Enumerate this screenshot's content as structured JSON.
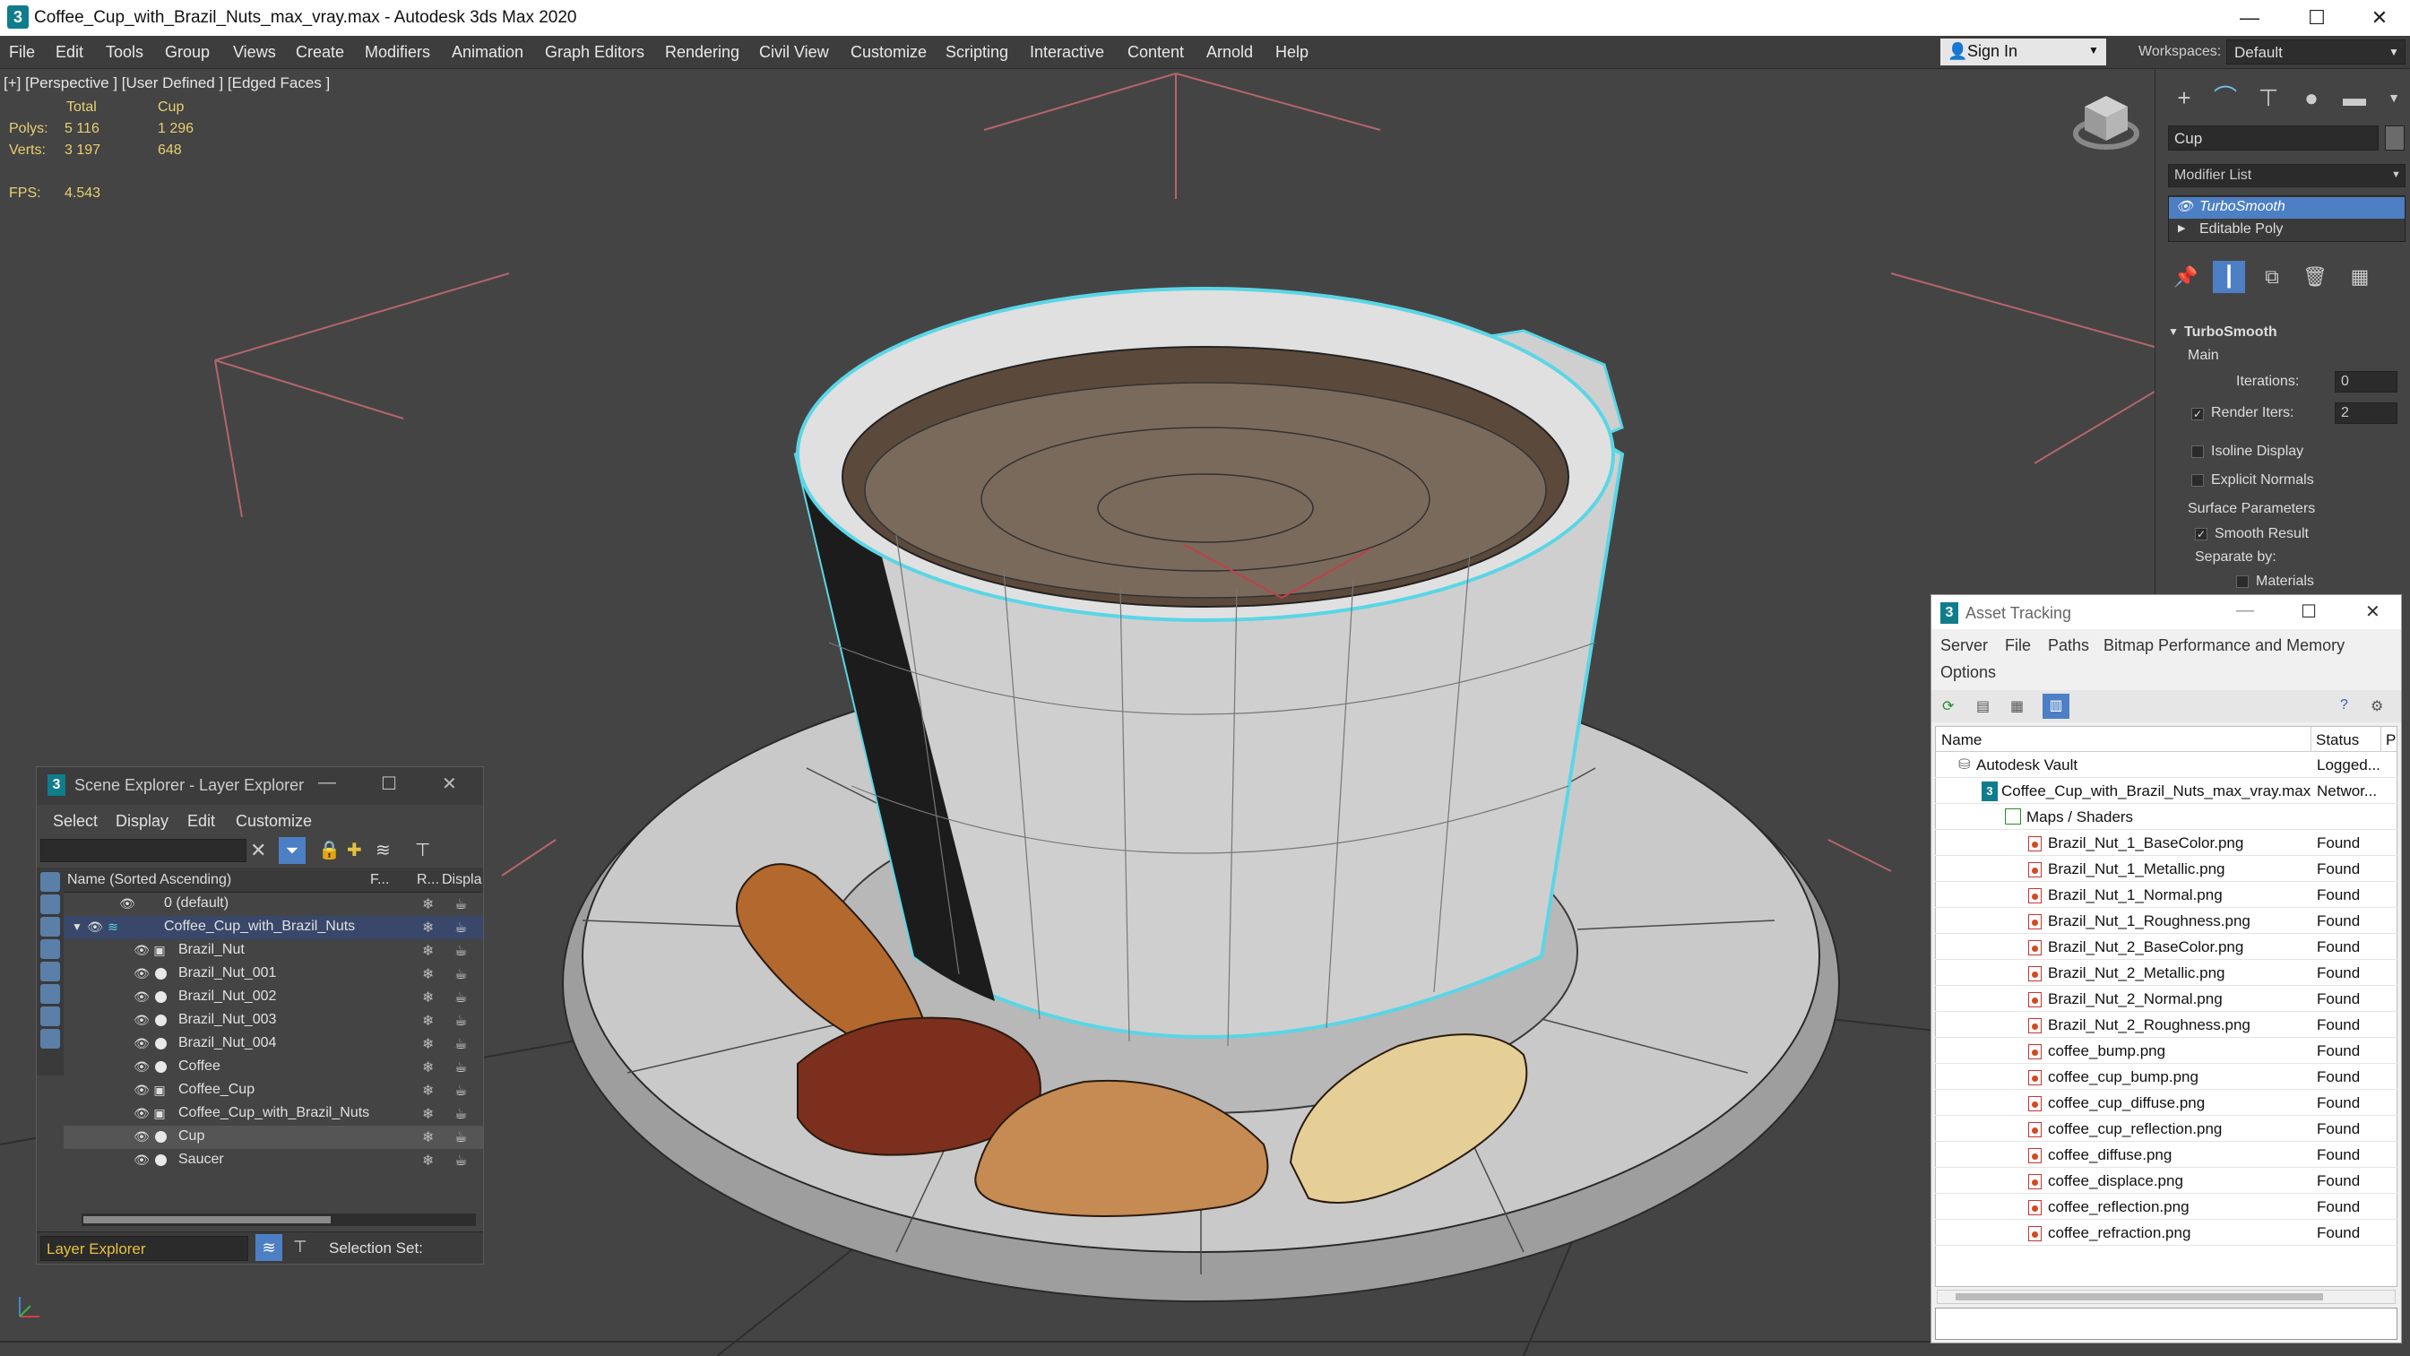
{
  "window": {
    "title": "Coffee_Cup_with_Brazil_Nuts_max_vray.max - Autodesk 3ds Max 2020",
    "logo": "3",
    "min": "—",
    "max": "☐",
    "close": "✕"
  },
  "menu": [
    "File",
    "Edit",
    "Tools",
    "Group",
    "Views",
    "Create",
    "Modifiers",
    "Animation",
    "Graph Editors",
    "Rendering",
    "Civil View",
    "Customize",
    "Scripting",
    "Interactive",
    "Content",
    "Arnold",
    "Help"
  ],
  "signin": {
    "label": "Sign In"
  },
  "workspaces": {
    "label": "Workspaces:",
    "value": "Default"
  },
  "viewport": {
    "label": "[+] [Perspective ] [User Defined ] [Edged Faces ]",
    "stats": {
      "col_total": "Total",
      "col_sel": "Cup",
      "polys_label": "Polys:",
      "polys_total": "5 116",
      "polys_sel": "1 296",
      "verts_label": "Verts:",
      "verts_total": "3 197",
      "verts_sel": "648",
      "fps_label": "FPS:",
      "fps": "4.543"
    }
  },
  "command_panel": {
    "object_name": "Cup",
    "modifier_list": "Modifier List",
    "stack": [
      "TurboSmooth",
      "Editable Poly"
    ],
    "rollout_title": "TurboSmooth",
    "main": "Main",
    "iterations_label": "Iterations:",
    "iterations": "0",
    "render_iters_label": "Render Iters:",
    "render_iters": "2",
    "isoline": "Isoline Display",
    "explicit": "Explicit Normals",
    "surface": "Surface Parameters",
    "smooth_result": "Smooth Result",
    "separate_by": "Separate by:",
    "materials": "Materials"
  },
  "scene_explorer": {
    "title": "Scene Explorer - Layer Explorer",
    "menu": [
      "Select",
      "Display",
      "Edit",
      "Customize"
    ],
    "col_name": "Name (Sorted Ascending)",
    "col_f": "F...",
    "col_r": "R...",
    "col_d": "Displa",
    "rows": [
      "0 (default)",
      "Coffee_Cup_with_Brazil_Nuts",
      "Brazil_Nut",
      "Brazil_Nut_001",
      "Brazil_Nut_002",
      "Brazil_Nut_003",
      "Brazil_Nut_004",
      "Coffee",
      "Coffee_Cup",
      "Coffee_Cup_with_Brazil_Nuts",
      "Cup",
      "Saucer"
    ],
    "footer": "Layer Explorer",
    "selection_set": "Selection Set:"
  },
  "asset_tracking": {
    "title": "Asset Tracking",
    "menu": [
      "Server",
      "File",
      "Paths",
      "Bitmap Performance and Memory",
      "Options"
    ],
    "col_name": "Name",
    "col_status": "Status",
    "col_p": "P",
    "rows": [
      {
        "name": "Autodesk Vault",
        "status": "Logged..."
      },
      {
        "name": "Coffee_Cup_with_Brazil_Nuts_max_vray.max",
        "status": "Networ..."
      },
      {
        "name": "Maps / Shaders",
        "status": ""
      },
      {
        "name": "Brazil_Nut_1_BaseColor.png",
        "status": "Found"
      },
      {
        "name": "Brazil_Nut_1_Metallic.png",
        "status": "Found"
      },
      {
        "name": "Brazil_Nut_1_Normal.png",
        "status": "Found"
      },
      {
        "name": "Brazil_Nut_1_Roughness.png",
        "status": "Found"
      },
      {
        "name": "Brazil_Nut_2_BaseColor.png",
        "status": "Found"
      },
      {
        "name": "Brazil_Nut_2_Metallic.png",
        "status": "Found"
      },
      {
        "name": "Brazil_Nut_2_Normal.png",
        "status": "Found"
      },
      {
        "name": "Brazil_Nut_2_Roughness.png",
        "status": "Found"
      },
      {
        "name": "coffee_bump.png",
        "status": "Found"
      },
      {
        "name": "coffee_cup_bump.png",
        "status": "Found"
      },
      {
        "name": "coffee_cup_diffuse.png",
        "status": "Found"
      },
      {
        "name": "coffee_cup_reflection.png",
        "status": "Found"
      },
      {
        "name": "coffee_diffuse.png",
        "status": "Found"
      },
      {
        "name": "coffee_displace.png",
        "status": "Found"
      },
      {
        "name": "coffee_reflection.png",
        "status": "Found"
      },
      {
        "name": "coffee_refraction.png",
        "status": "Found"
      }
    ]
  }
}
